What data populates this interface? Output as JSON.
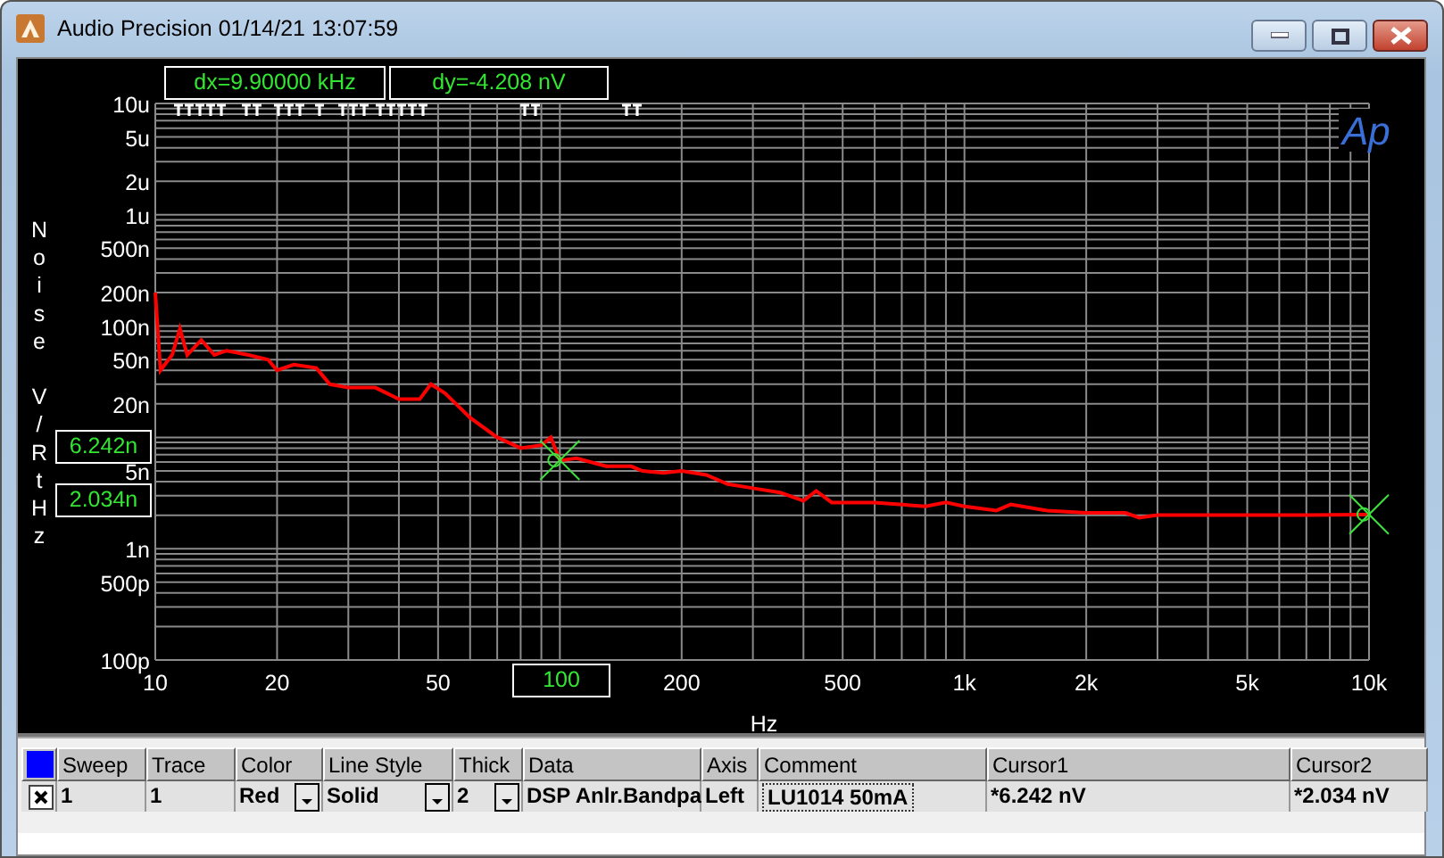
{
  "window": {
    "title": "Audio Precision  01/14/21 13:07:59"
  },
  "plot": {
    "dx_readout": "dx=9.90000 kHz",
    "dy_readout": "dy=-4.208  nV",
    "x_readout": "100",
    "logo": "Ap",
    "y_readouts": [
      "6.242n",
      "2.034n"
    ],
    "y_axis_title": "Noise V/RtHz",
    "x_axis_title": "Hz",
    "y_tick_labels": [
      "10u",
      "5u",
      "2u",
      "1u",
      "500n",
      "200n",
      "100n",
      "50n",
      "20n",
      "5n",
      "1n",
      "500p",
      "100p"
    ],
    "x_tick_labels": [
      "10",
      "20",
      "50",
      "200",
      "500",
      "1k",
      "2k",
      "5k",
      "10k"
    ]
  },
  "legend": {
    "columns": [
      "Sweep",
      "Trace",
      "Color",
      "Line Style",
      "Thick",
      "Data",
      "Axis",
      "Comment",
      "Cursor1",
      "Cursor2"
    ],
    "rows": [
      {
        "checked": true,
        "cells": [
          {
            "kind": "text",
            "text": "1"
          },
          {
            "kind": "text",
            "text": "1"
          },
          {
            "kind": "dropdown",
            "text": "Red"
          },
          {
            "kind": "dropdown",
            "text": "Solid"
          },
          {
            "kind": "dropdown",
            "text": "2"
          },
          {
            "kind": "text",
            "text": "DSP Anlr.Bandpa"
          },
          {
            "kind": "text",
            "text": "Left"
          },
          {
            "kind": "edit",
            "text": "LU1014 50mA"
          },
          {
            "kind": "text",
            "text": "*6.242  nV"
          },
          {
            "kind": "text",
            "text": "*2.034  nV"
          }
        ]
      }
    ]
  }
}
